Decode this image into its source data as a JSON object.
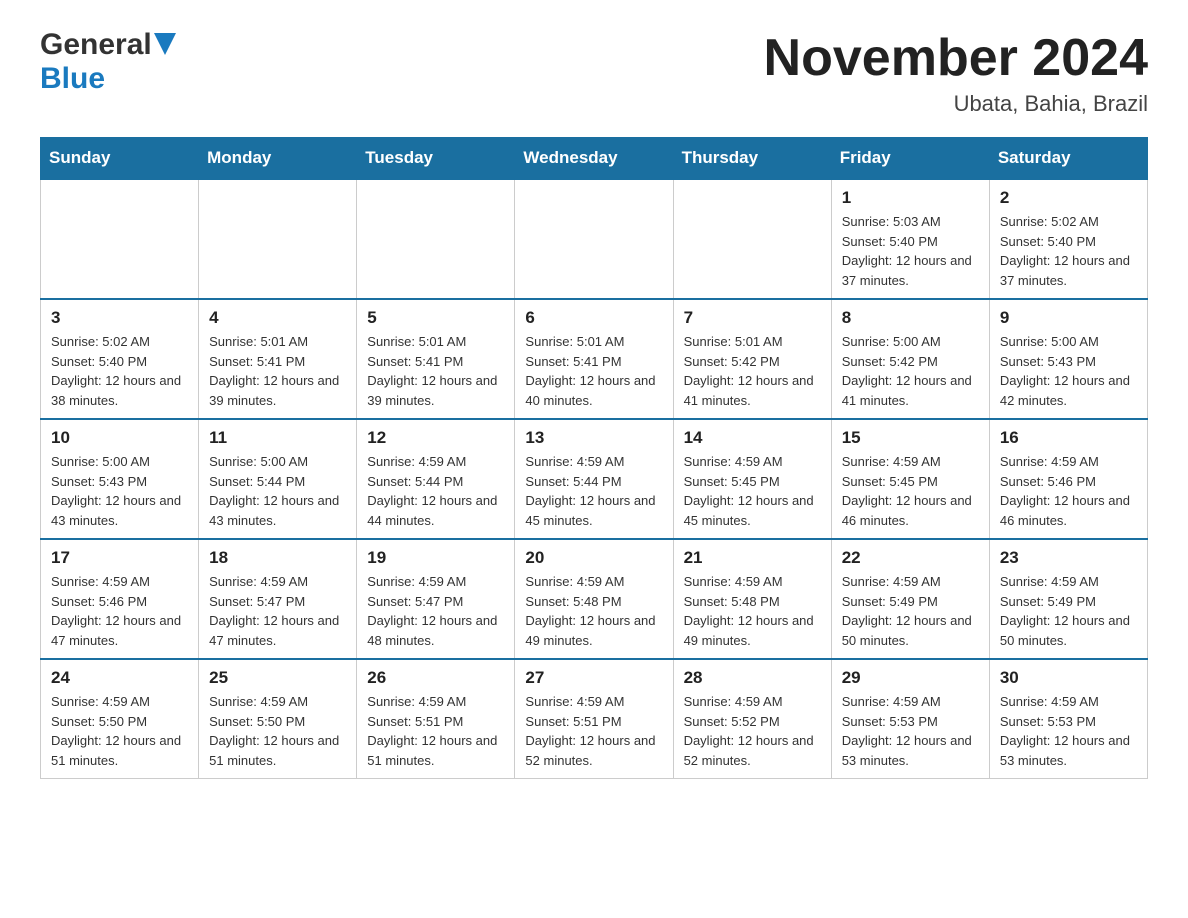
{
  "header": {
    "logo_general": "General",
    "logo_blue": "Blue",
    "month_title": "November 2024",
    "location": "Ubata, Bahia, Brazil"
  },
  "weekdays": [
    "Sunday",
    "Monday",
    "Tuesday",
    "Wednesday",
    "Thursday",
    "Friday",
    "Saturday"
  ],
  "weeks": [
    [
      {
        "day": "",
        "info": ""
      },
      {
        "day": "",
        "info": ""
      },
      {
        "day": "",
        "info": ""
      },
      {
        "day": "",
        "info": ""
      },
      {
        "day": "",
        "info": ""
      },
      {
        "day": "1",
        "info": "Sunrise: 5:03 AM\nSunset: 5:40 PM\nDaylight: 12 hours\nand 37 minutes."
      },
      {
        "day": "2",
        "info": "Sunrise: 5:02 AM\nSunset: 5:40 PM\nDaylight: 12 hours\nand 37 minutes."
      }
    ],
    [
      {
        "day": "3",
        "info": "Sunrise: 5:02 AM\nSunset: 5:40 PM\nDaylight: 12 hours\nand 38 minutes."
      },
      {
        "day": "4",
        "info": "Sunrise: 5:01 AM\nSunset: 5:41 PM\nDaylight: 12 hours\nand 39 minutes."
      },
      {
        "day": "5",
        "info": "Sunrise: 5:01 AM\nSunset: 5:41 PM\nDaylight: 12 hours\nand 39 minutes."
      },
      {
        "day": "6",
        "info": "Sunrise: 5:01 AM\nSunset: 5:41 PM\nDaylight: 12 hours\nand 40 minutes."
      },
      {
        "day": "7",
        "info": "Sunrise: 5:01 AM\nSunset: 5:42 PM\nDaylight: 12 hours\nand 41 minutes."
      },
      {
        "day": "8",
        "info": "Sunrise: 5:00 AM\nSunset: 5:42 PM\nDaylight: 12 hours\nand 41 minutes."
      },
      {
        "day": "9",
        "info": "Sunrise: 5:00 AM\nSunset: 5:43 PM\nDaylight: 12 hours\nand 42 minutes."
      }
    ],
    [
      {
        "day": "10",
        "info": "Sunrise: 5:00 AM\nSunset: 5:43 PM\nDaylight: 12 hours\nand 43 minutes."
      },
      {
        "day": "11",
        "info": "Sunrise: 5:00 AM\nSunset: 5:44 PM\nDaylight: 12 hours\nand 43 minutes."
      },
      {
        "day": "12",
        "info": "Sunrise: 4:59 AM\nSunset: 5:44 PM\nDaylight: 12 hours\nand 44 minutes."
      },
      {
        "day": "13",
        "info": "Sunrise: 4:59 AM\nSunset: 5:44 PM\nDaylight: 12 hours\nand 45 minutes."
      },
      {
        "day": "14",
        "info": "Sunrise: 4:59 AM\nSunset: 5:45 PM\nDaylight: 12 hours\nand 45 minutes."
      },
      {
        "day": "15",
        "info": "Sunrise: 4:59 AM\nSunset: 5:45 PM\nDaylight: 12 hours\nand 46 minutes."
      },
      {
        "day": "16",
        "info": "Sunrise: 4:59 AM\nSunset: 5:46 PM\nDaylight: 12 hours\nand 46 minutes."
      }
    ],
    [
      {
        "day": "17",
        "info": "Sunrise: 4:59 AM\nSunset: 5:46 PM\nDaylight: 12 hours\nand 47 minutes."
      },
      {
        "day": "18",
        "info": "Sunrise: 4:59 AM\nSunset: 5:47 PM\nDaylight: 12 hours\nand 47 minutes."
      },
      {
        "day": "19",
        "info": "Sunrise: 4:59 AM\nSunset: 5:47 PM\nDaylight: 12 hours\nand 48 minutes."
      },
      {
        "day": "20",
        "info": "Sunrise: 4:59 AM\nSunset: 5:48 PM\nDaylight: 12 hours\nand 49 minutes."
      },
      {
        "day": "21",
        "info": "Sunrise: 4:59 AM\nSunset: 5:48 PM\nDaylight: 12 hours\nand 49 minutes."
      },
      {
        "day": "22",
        "info": "Sunrise: 4:59 AM\nSunset: 5:49 PM\nDaylight: 12 hours\nand 50 minutes."
      },
      {
        "day": "23",
        "info": "Sunrise: 4:59 AM\nSunset: 5:49 PM\nDaylight: 12 hours\nand 50 minutes."
      }
    ],
    [
      {
        "day": "24",
        "info": "Sunrise: 4:59 AM\nSunset: 5:50 PM\nDaylight: 12 hours\nand 51 minutes."
      },
      {
        "day": "25",
        "info": "Sunrise: 4:59 AM\nSunset: 5:50 PM\nDaylight: 12 hours\nand 51 minutes."
      },
      {
        "day": "26",
        "info": "Sunrise: 4:59 AM\nSunset: 5:51 PM\nDaylight: 12 hours\nand 51 minutes."
      },
      {
        "day": "27",
        "info": "Sunrise: 4:59 AM\nSunset: 5:51 PM\nDaylight: 12 hours\nand 52 minutes."
      },
      {
        "day": "28",
        "info": "Sunrise: 4:59 AM\nSunset: 5:52 PM\nDaylight: 12 hours\nand 52 minutes."
      },
      {
        "day": "29",
        "info": "Sunrise: 4:59 AM\nSunset: 5:53 PM\nDaylight: 12 hours\nand 53 minutes."
      },
      {
        "day": "30",
        "info": "Sunrise: 4:59 AM\nSunset: 5:53 PM\nDaylight: 12 hours\nand 53 minutes."
      }
    ]
  ]
}
